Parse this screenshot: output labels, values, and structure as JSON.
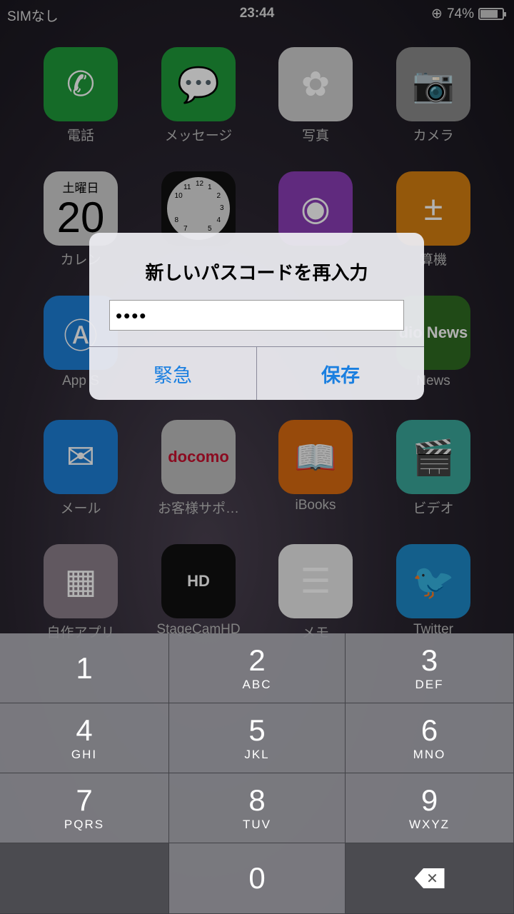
{
  "status_bar": {
    "carrier": "SIMなし",
    "time": "23:44",
    "battery_percent": "74%",
    "battery_level": 0.74,
    "icons": [
      "rotation-lock-icon",
      "battery-icon"
    ]
  },
  "apps": [
    {
      "label": "電話",
      "icon": "phone-icon",
      "color": "#1f9a3a"
    },
    {
      "label": "メッセージ",
      "icon": "messages-icon",
      "color": "#1f9a3a"
    },
    {
      "label": "写真",
      "icon": "photos-icon",
      "color": "#cfcfcf"
    },
    {
      "label": "カメラ",
      "icon": "camera-icon",
      "color": "#8a8a8a"
    },
    {
      "label": "カレン",
      "icon": "calendar-icon",
      "color": "#cfcfcf",
      "day": "土曜日",
      "date": "20"
    },
    {
      "label": "",
      "icon": "clock-icon",
      "color": "#111111",
      "clock_numbers": [
        "12",
        "1",
        "2",
        "3",
        "4",
        "5",
        "7",
        "8",
        "10",
        "11"
      ]
    },
    {
      "label": "",
      "icon": "podcasts-icon",
      "color": "#8a3db5"
    },
    {
      "label": "算機",
      "icon": "calculator-icon",
      "color": "#d57f10"
    },
    {
      "label": "App S",
      "icon": "app-store-icon",
      "color": "#1e7ed6"
    },
    {
      "label": "",
      "icon": "",
      "color": ""
    },
    {
      "label": "",
      "icon": "",
      "color": ""
    },
    {
      "label": "News",
      "icon": "radio-news-icon",
      "color": "#2f6b22",
      "icon_text": "dio News"
    },
    {
      "label": "メール",
      "icon": "mail-icon",
      "color": "#1e7ed6"
    },
    {
      "label": "お客様サポ…",
      "icon": "docomo-support-icon",
      "color": "#bdbdbd",
      "icon_text": "docomo"
    },
    {
      "label": "iBooks",
      "icon": "ibooks-icon",
      "color": "#d86a10"
    },
    {
      "label": "ビデオ",
      "icon": "videos-icon",
      "color": "#3aa79a"
    },
    {
      "label": "自作アプリ",
      "icon": "folder-icon",
      "color": "#8c7f8a"
    },
    {
      "label": "StageCamHD",
      "icon": "stagecam-icon",
      "color": "#111111",
      "icon_text": "HD"
    },
    {
      "label": "メモ",
      "icon": "notes-icon",
      "color": "#e8e8e8"
    },
    {
      "label": "Twitter",
      "icon": "twitter-icon",
      "color": "#1e88c8"
    }
  ],
  "alert": {
    "title": "新しいパスコードを再入力",
    "password_value": "••••",
    "buttons": [
      "緊急",
      "保存"
    ],
    "accent": "#1a7fe0"
  },
  "keypad": [
    {
      "n": "1",
      "s": ""
    },
    {
      "n": "2",
      "s": "ABC"
    },
    {
      "n": "3",
      "s": "DEF"
    },
    {
      "n": "4",
      "s": "GHI"
    },
    {
      "n": "5",
      "s": "JKL"
    },
    {
      "n": "6",
      "s": "MNO"
    },
    {
      "n": "7",
      "s": "PQRS"
    },
    {
      "n": "8",
      "s": "TUV"
    },
    {
      "n": "9",
      "s": "WXYZ"
    },
    {
      "n": "",
      "s": ""
    },
    {
      "n": "0",
      "s": ""
    },
    {
      "n": "delete",
      "s": ""
    }
  ]
}
